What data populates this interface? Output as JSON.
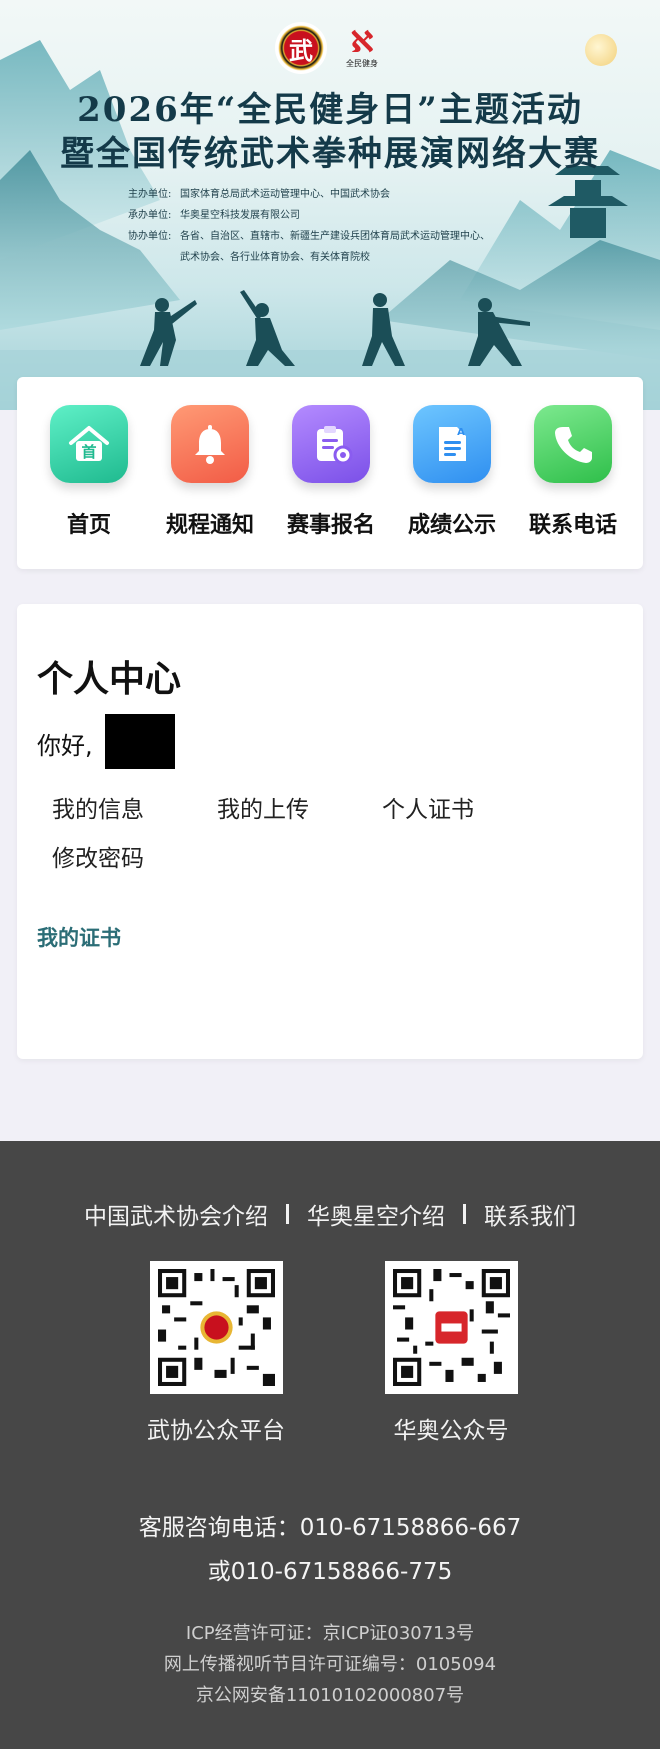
{
  "banner": {
    "logo_char": "武",
    "logo2_mark": "ℵ",
    "logo2_text": "全民健身",
    "title_line1": "2026年“全民健身日”主题活动",
    "title_line2": "暨全国传统武术拳种展演网络大赛",
    "orgs": [
      {
        "key": "主办单位:",
        "value": "国家体育总局武术运动管理中心、中国武术协会"
      },
      {
        "key": "承办单位:",
        "value": "华奥星空科技发展有限公司"
      },
      {
        "key": "协办单位:",
        "value": "各省、自治区、直辖市、新疆生产建设兵团体育局武术运动管理中心、"
      },
      {
        "key": "",
        "value": "武术协会、各行业体育协会、有关体育院校"
      }
    ]
  },
  "nav": {
    "items": [
      {
        "label": "首页",
        "icon": "home-icon",
        "glyph": "首"
      },
      {
        "label": "规程通知",
        "icon": "bell-icon"
      },
      {
        "label": "赛事报名",
        "icon": "clipboard-icon"
      },
      {
        "label": "成绩公示",
        "icon": "document-icon"
      },
      {
        "label": "联系电话",
        "icon": "phone-icon"
      }
    ]
  },
  "personal": {
    "title": "个人中心",
    "greeting": "你好,",
    "links": [
      "我的信息",
      "我的上传",
      "个人证书",
      "修改密码"
    ],
    "section": "我的证书"
  },
  "footer": {
    "links": [
      "中国武术协会介绍",
      "华奥星空介绍",
      "联系我们"
    ],
    "qr": [
      {
        "label": "武协公众平台"
      },
      {
        "label": "华奥公众号"
      }
    ],
    "phone_line1": "客服咨询电话：010-67158866-667",
    "phone_line2": "或010-67158866-775",
    "license1": "ICP经营许可证：京ICP证030713号",
    "license2": "网上传播视听节目许可证编号：0105094",
    "license3": "京公网安备11010102000807号"
  },
  "colors": {
    "accent_link": "#2b6d76",
    "footer_bg": "#474747"
  }
}
